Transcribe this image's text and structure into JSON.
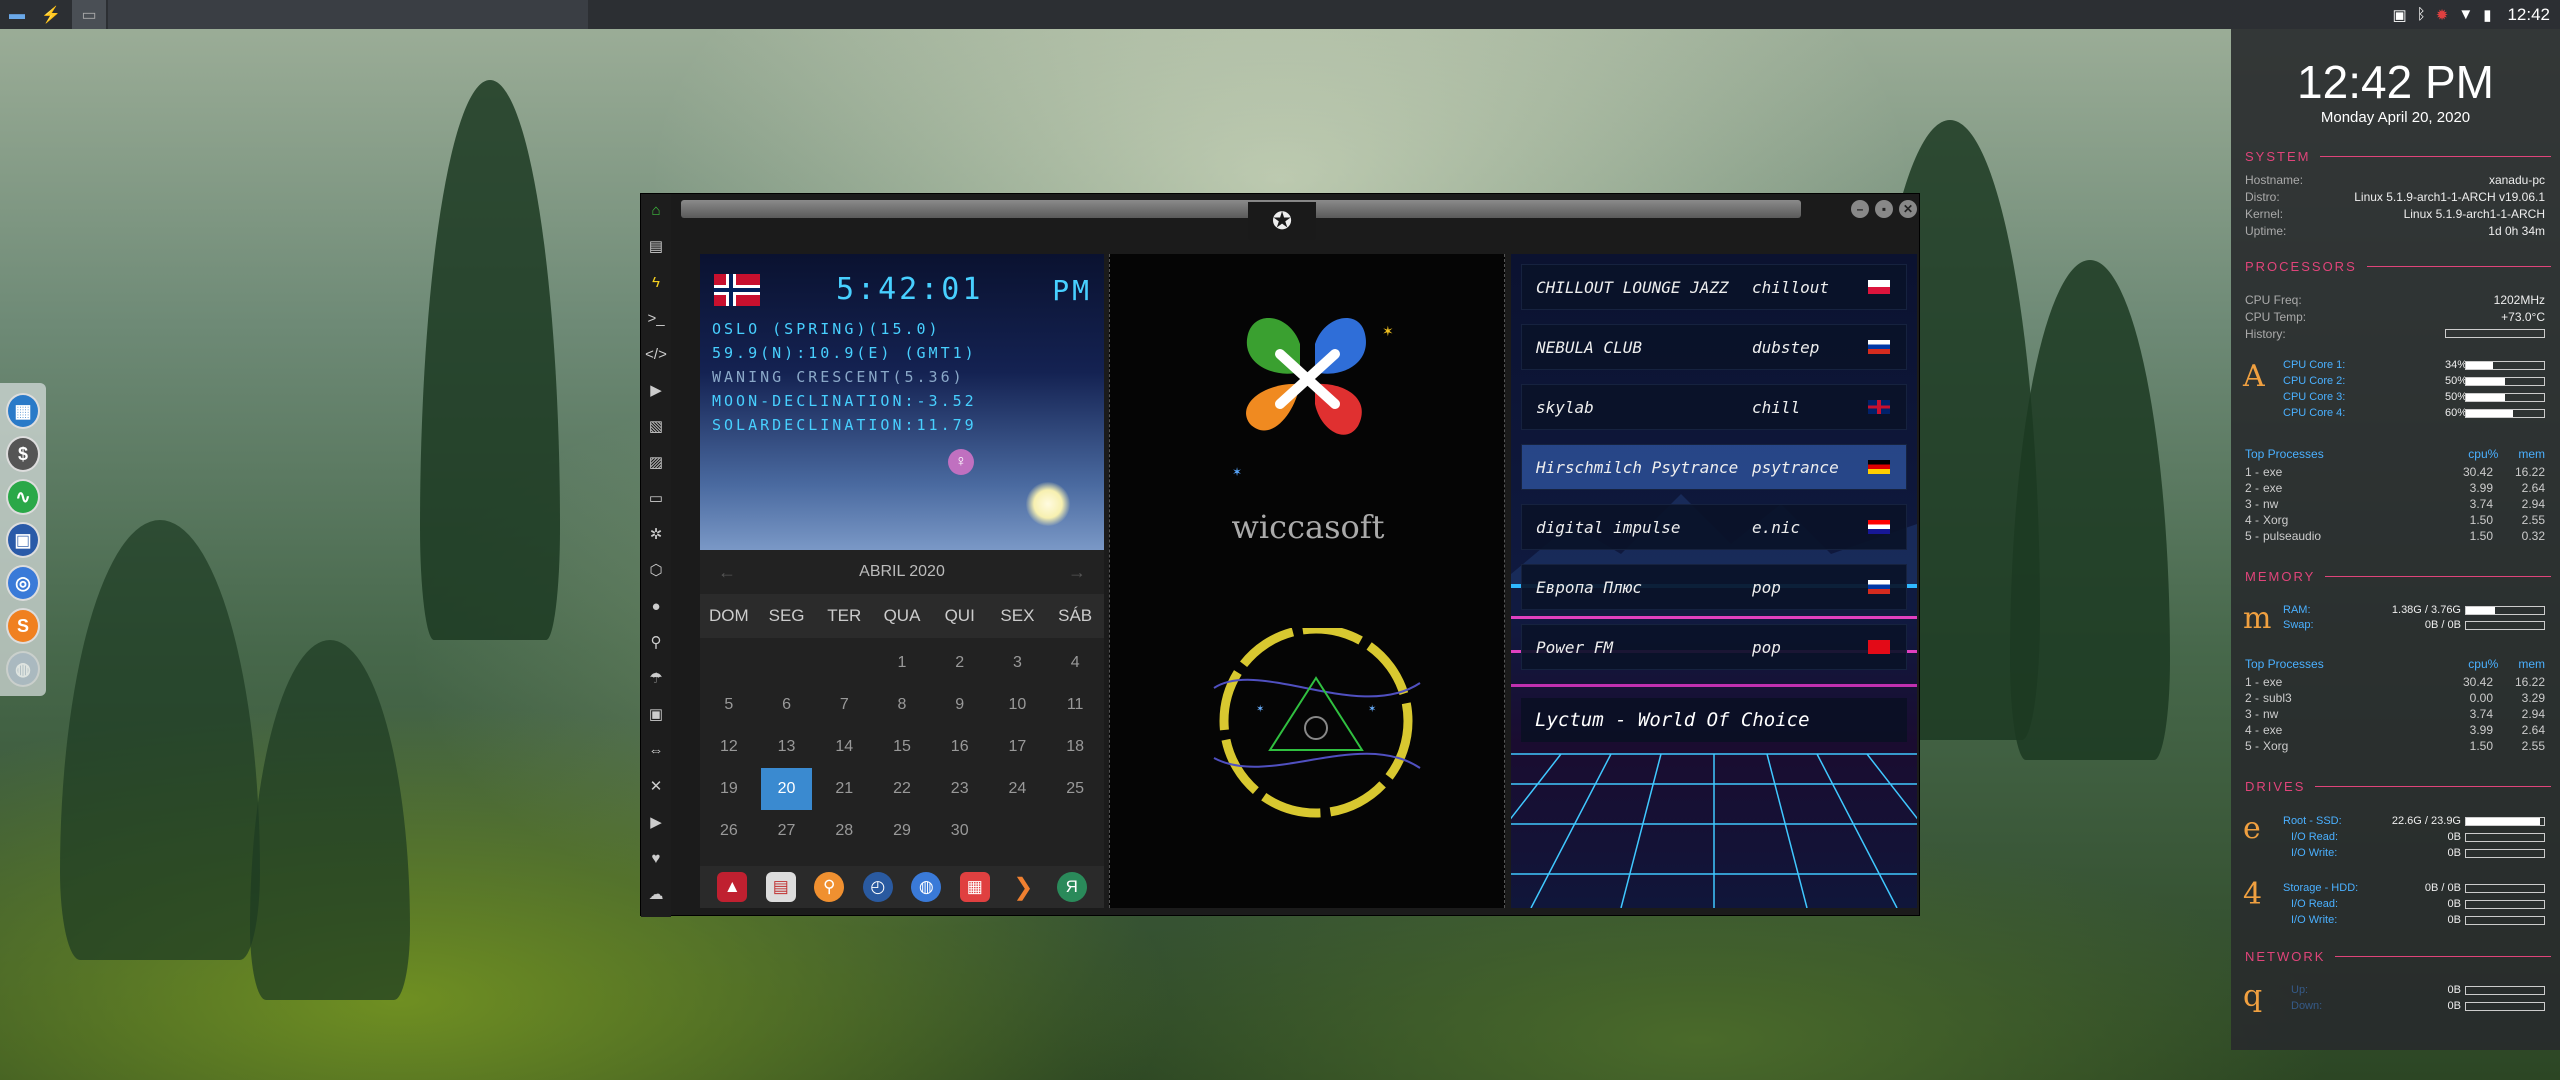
{
  "topbar": {
    "tray_clock": "12:42",
    "taskbar_items": [
      "files-icon",
      "sublime-icon",
      "window-icon"
    ]
  },
  "dock": {
    "items": [
      "calendar-app-icon",
      "money-app-icon",
      "activity-app-icon",
      "screenshot-app-icon",
      "chrome-icon",
      "sublime-s-icon",
      "globe-icon"
    ]
  },
  "window": {
    "clock": {
      "time": "5:42:01",
      "ampm": "PM"
    },
    "astro": {
      "line1": "OSLO (SPRING)(15.0)",
      "line2": "59.9(N):10.9(E) (GMT1)",
      "line3": "WANING CRESCENT(5.36)",
      "line4": "MOON-DECLINATION:-3.52",
      "line5": "SOLARDECLINATION:11.79"
    },
    "calendar": {
      "month": "ABRIL 2020",
      "prev": "←",
      "next": "→",
      "dows": [
        "DOM",
        "SEG",
        "TER",
        "QUA",
        "QUI",
        "SEX",
        "SÁB"
      ],
      "days": [
        "",
        "",
        "",
        "1",
        "2",
        "3",
        "4",
        "5",
        "6",
        "7",
        "8",
        "9",
        "10",
        "11",
        "12",
        "13",
        "14",
        "15",
        "16",
        "17",
        "18",
        "19",
        "20",
        "21",
        "22",
        "23",
        "24",
        "25",
        "26",
        "27",
        "28",
        "29",
        "30",
        "",
        ""
      ],
      "today": "20"
    },
    "wiccasoft": {
      "brand": "wiccasoft"
    },
    "stations": [
      {
        "name": "CHILLOUT LOUNGE JAZZ",
        "genre": "chillout",
        "flag": "poland"
      },
      {
        "name": "NEBULA CLUB",
        "genre": "dubstep",
        "flag": "russia"
      },
      {
        "name": "skylab",
        "genre": "chill",
        "flag": "uk"
      },
      {
        "name": "Hirschmilch Psytrance",
        "genre": "psytrance",
        "flag": "germany"
      },
      {
        "name": "digital impulse",
        "genre": "e.nic",
        "flag": "croatia"
      },
      {
        "name": "Европа Плюс",
        "genre": "pop",
        "flag": "russia"
      },
      {
        "name": "Power FM",
        "genre": "pop",
        "flag": "turkey"
      }
    ],
    "radio_title": "Lyctum - World Of Choice"
  },
  "conky": {
    "time": "12:42 PM",
    "date": "Monday April 20, 2020",
    "system": {
      "title": "SYSTEM",
      "hostname_k": "Hostname:",
      "hostname_v": "xanadu-pc",
      "distro_k": "Distro:",
      "distro_v": "Linux 5.1.9-arch1-1-ARCH v19.06.1",
      "kernel_k": "Kernel:",
      "kernel_v": "Linux 5.1.9-arch1-1-ARCH",
      "uptime_k": "Uptime:",
      "uptime_v": "1d 0h 34m"
    },
    "processors": {
      "title": "PROCESSORS",
      "freq_k": "CPU Freq:",
      "freq_v": "1202MHz",
      "temp_k": "CPU Temp:",
      "temp_v": "+73.0°C",
      "hist_k": "History:",
      "glyph": "A",
      "cores": [
        {
          "k": "CPU Core 1:",
          "v": "34%",
          "pct": 34
        },
        {
          "k": "CPU Core 2:",
          "v": "50%",
          "pct": 50
        },
        {
          "k": "CPU Core 3:",
          "v": "50%",
          "pct": 50
        },
        {
          "k": "CPU Core 4:",
          "v": "60%",
          "pct": 60
        }
      ],
      "top_title": "Top Processes",
      "h_cpu": "cpu%",
      "h_mem": "mem",
      "top": [
        {
          "n": "1 -",
          "name": "exe",
          "cpu": "30.42",
          "mem": "16.22"
        },
        {
          "n": "2 -",
          "name": "exe",
          "cpu": "3.99",
          "mem": "2.64"
        },
        {
          "n": "3 -",
          "name": "nw",
          "cpu": "3.74",
          "mem": "2.94"
        },
        {
          "n": "4 -",
          "name": "Xorg",
          "cpu": "1.50",
          "mem": "2.55"
        },
        {
          "n": "5 -",
          "name": "pulseaudio",
          "cpu": "1.50",
          "mem": "0.32"
        }
      ]
    },
    "memory": {
      "title": "MEMORY",
      "glyph": "m",
      "ram_k": "RAM:",
      "ram_v": "1.38G / 3.76G",
      "ram_pct": 37,
      "swap_k": "Swap:",
      "swap_v": "0B / 0B",
      "swap_pct": 0,
      "top_title": "Top Processes",
      "h_cpu": "cpu%",
      "h_mem": "mem",
      "top": [
        {
          "n": "1 -",
          "name": "exe",
          "cpu": "30.42",
          "mem": "16.22"
        },
        {
          "n": "2 -",
          "name": "subl3",
          "cpu": "0.00",
          "mem": "3.29"
        },
        {
          "n": "3 -",
          "name": "nw",
          "cpu": "3.74",
          "mem": "2.94"
        },
        {
          "n": "4 -",
          "name": "exe",
          "cpu": "3.99",
          "mem": "2.64"
        },
        {
          "n": "5 -",
          "name": "Xorg",
          "cpu": "1.50",
          "mem": "2.55"
        }
      ]
    },
    "drives": {
      "title": "DRIVES",
      "ssd_glyph": "e",
      "ssd_k": "Root - SSD:",
      "ssd_v": "22.6G / 23.9G",
      "ssd_pct": 95,
      "ssd_r_k": "I/O Read:",
      "ssd_r_v": "0B",
      "ssd_w_k": "I/O Write:",
      "ssd_w_v": "0B",
      "hdd_glyph": "4",
      "hdd_k": "Storage - HDD:",
      "hdd_v": "0B / 0B",
      "hdd_pct": 0,
      "hdd_r_k": "I/O Read:",
      "hdd_r_v": "0B",
      "hdd_w_k": "I/O Write:",
      "hdd_w_v": "0B"
    },
    "network": {
      "title": "NETWORK",
      "glyph": "q",
      "up_k": "Up:",
      "up_v": "0B",
      "down_k": "Down:",
      "down_v": "0B"
    }
  }
}
